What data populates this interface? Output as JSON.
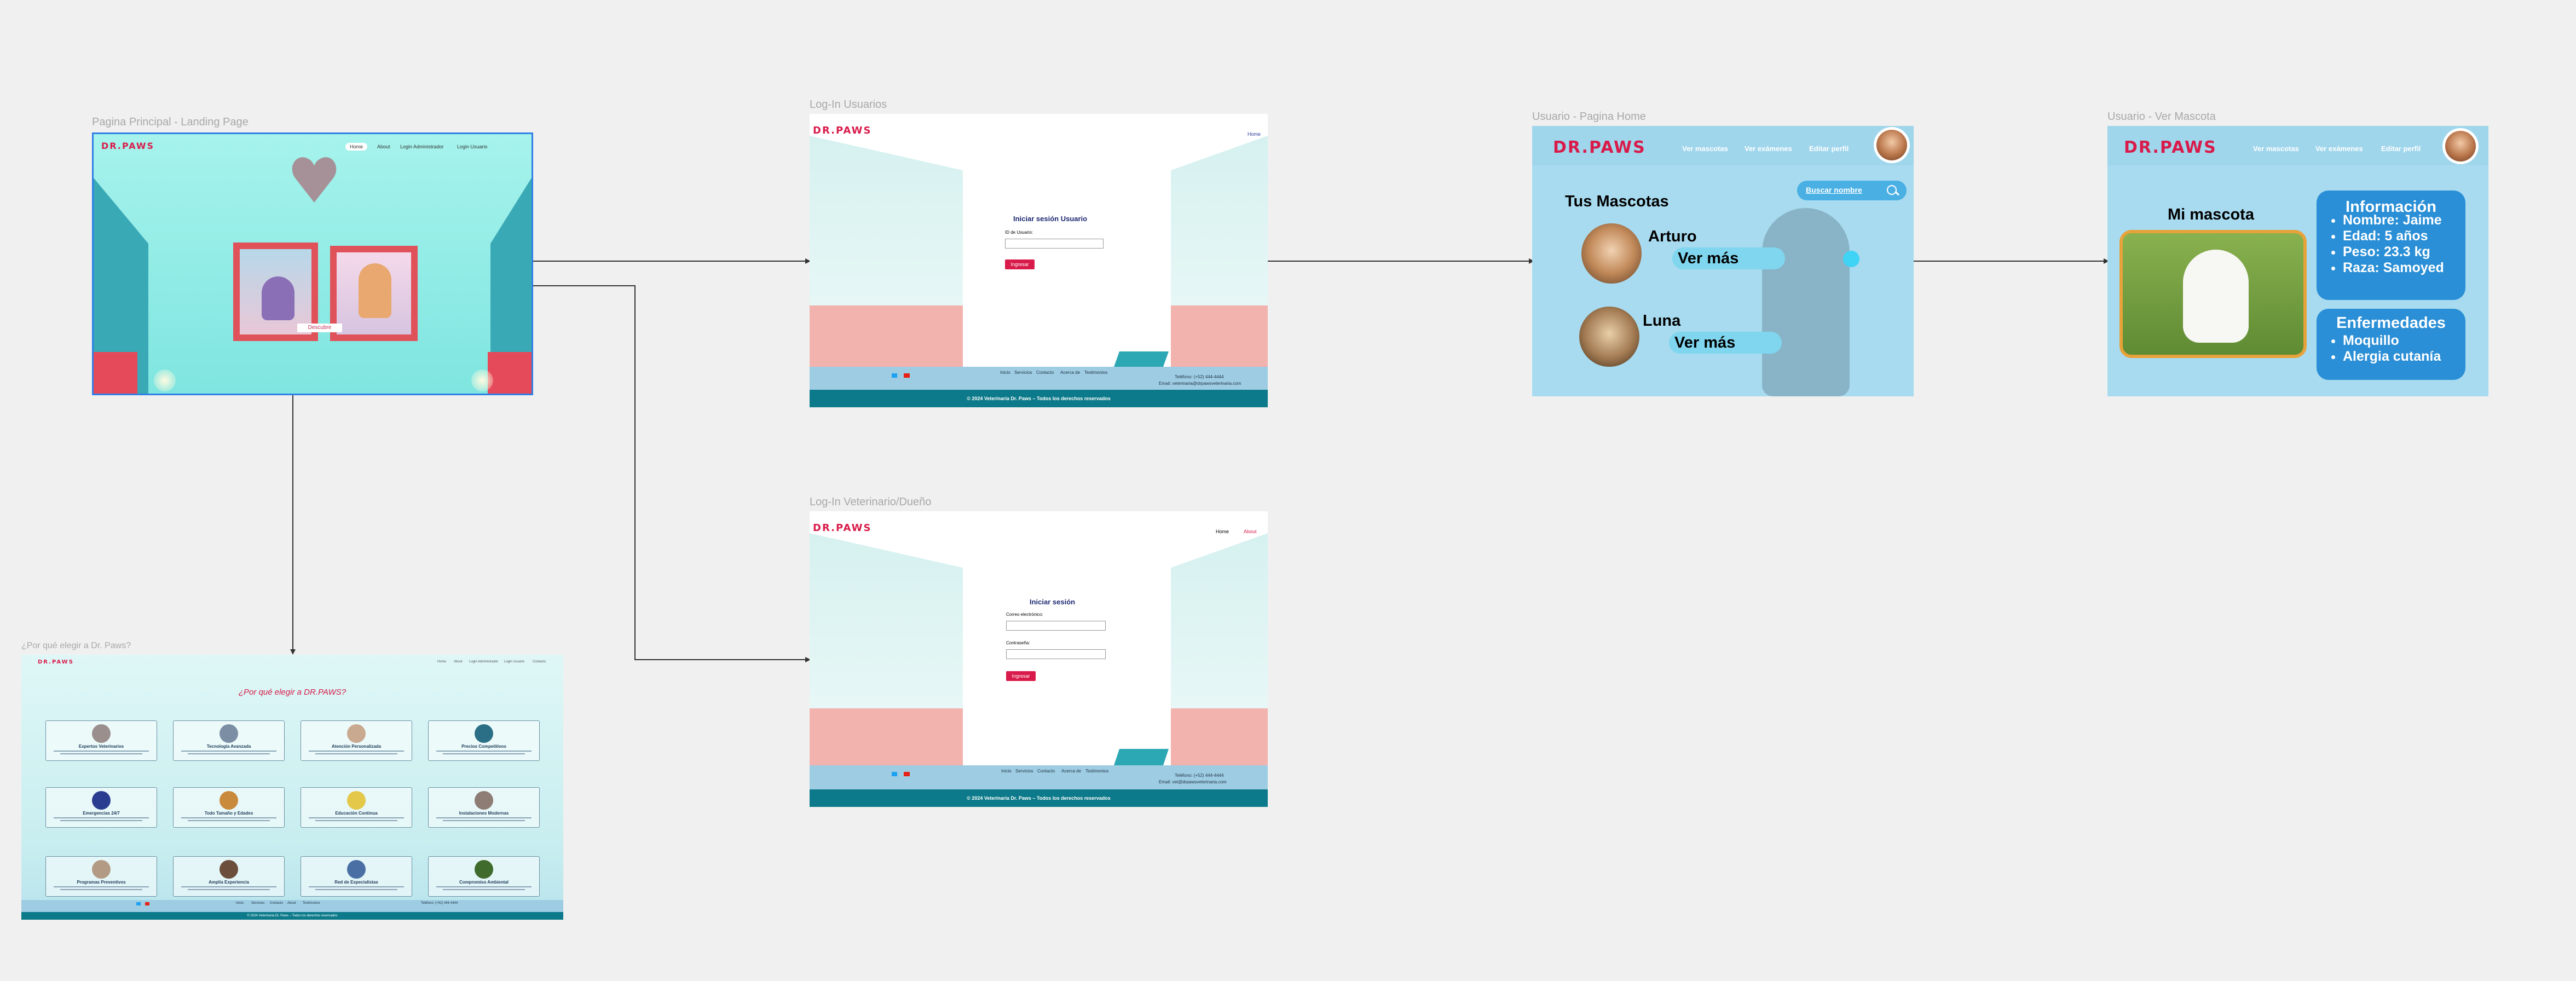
{
  "frames": {
    "landing": {
      "label": "Pagina Principal - Landing Page",
      "logo": "DR.PAWS",
      "nav": [
        "Home",
        "About",
        "Login Administrador",
        "Login Usuario"
      ],
      "cta": "Descubre"
    },
    "why": {
      "label": "¿Por qué elegir a Dr. Paws?",
      "logo": "DR.PAWS",
      "nav": [
        "Home",
        "About",
        "Login Administrador",
        "Login Usuario",
        "Contacto"
      ],
      "heading": "¿Por qué elegir a DR.PAWS?",
      "cards": [
        "Expertos Veterinarios",
        "Tecnología Avanzada",
        "Atención Personalizada",
        "Precios Competitivos",
        "Emergencias 24/7",
        "Todo Tamaño y Edades",
        "Educación Continua",
        "Instalaciones Modernas",
        "Programas Preventivos",
        "Amplia Experiencia",
        "Red de Especialistas",
        "Compromiso Ambiental"
      ],
      "footer_links": [
        "Inicio",
        "Servicios",
        "Contacto",
        "About",
        "Testimonios"
      ],
      "footer_phone": "Teléfono: (+52) 444-4444",
      "footer_copy": "© 2024 Veterinaria Dr. Paws – Todos los derechos reservados"
    },
    "login_user": {
      "label": "Log-In Usuarios",
      "logo": "DR.PAWS",
      "nav_home": "Home",
      "title": "Iniciar sesión Usuario",
      "field_label": "ID de Usuario:",
      "button": "Ingresar",
      "footer_links": [
        "Inicio",
        "Servicios",
        "Contacto",
        "Acerca de",
        "Testimonios"
      ],
      "phone": "Teléfono: (+52) 444-4444",
      "email": "Email: veterinaria@drpawsveterinaria.com",
      "copyright": "© 2024 Veterinaria Dr. Paws – Todos los derechos reservados"
    },
    "login_vet": {
      "label": "Log-In Veterinario/Dueño",
      "logo": "DR.PAWS",
      "nav": [
        "Home",
        "About"
      ],
      "title": "Iniciar sesión",
      "email_label": "Correo electrónico:",
      "password_label": "Contraseña:",
      "button": "Ingresar",
      "footer_links": [
        "Inicio",
        "Servicios",
        "Contacto",
        "Acerca de",
        "Testimonios"
      ],
      "phone": "Teléfono: (+52) 444-4444",
      "email": "Email: vet@drpawsveterinaria.com",
      "copyright": "© 2024 Veterinaria Dr. Paws – Todos los derechos reservados"
    },
    "user_home": {
      "label": "Usuario - Pagina Home",
      "logo": "DR.PAWS",
      "nav": [
        "Ver mascotas",
        "Ver exámenes",
        "Editar perfil"
      ],
      "search_placeholder": "Buscar nombre",
      "heading": "Tus Mascotas",
      "pets": [
        {
          "name": "Arturo",
          "button": "Ver más"
        },
        {
          "name": "Luna",
          "button": "Ver más"
        }
      ]
    },
    "user_pet": {
      "label": "Usuario - Ver Mascota",
      "logo": "DR.PAWS",
      "nav": [
        "Ver mascotas",
        "Ver exámenes",
        "Editar perfil"
      ],
      "heading": "Mi mascota",
      "info_title": "Información",
      "info_items": [
        "Nombre: Jaime",
        "Edad: 5 años",
        "Peso: 23.3 kg",
        "Raza: Samoyed"
      ],
      "disease_title": "Enfermedades",
      "disease_items": [
        "Moquillo",
        "Alergia cutanía"
      ]
    }
  },
  "colors": {
    "canvas": "#f0f0f0",
    "brand": "#d81b4a",
    "teal": "#0c7a8a",
    "sky": "#a8dbef",
    "select": "#2f7fe6"
  }
}
